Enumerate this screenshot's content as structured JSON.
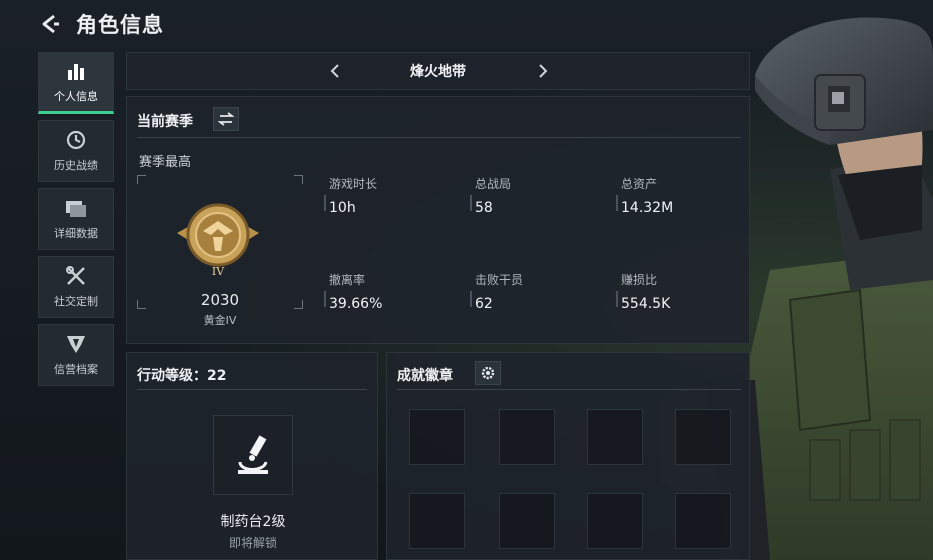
{
  "header": {
    "title": "角色信息"
  },
  "sidebar": {
    "items": [
      {
        "label": "个人信息",
        "icon": "bar-chart-icon",
        "active": true
      },
      {
        "label": "历史战绩",
        "icon": "history-clock-icon",
        "active": false
      },
      {
        "label": "详细数据",
        "icon": "folder-icon",
        "active": false
      },
      {
        "label": "社交定制",
        "icon": "tools-icon",
        "active": false
      },
      {
        "label": "信营档案",
        "icon": "emblem-icon",
        "active": false
      }
    ]
  },
  "mode_bar": {
    "name": "烽火地带",
    "prev_icon": "chevron-left-icon",
    "next_icon": "chevron-right-icon"
  },
  "season": {
    "title": "当前赛季",
    "best_label": "赛季最高",
    "rank_score": "2030",
    "rank_tier": "黄金IV",
    "rank_badge_numeral": "IV",
    "stats": [
      {
        "label": "游戏时长",
        "value": "10h"
      },
      {
        "label": "总战局",
        "value": "58"
      },
      {
        "label": "总资产",
        "value": "14.32M"
      },
      {
        "label": "撤离率",
        "value": "39.66%"
      },
      {
        "label": "击败干员",
        "value": "62"
      },
      {
        "label": "赚损比",
        "value": "554.5K"
      }
    ]
  },
  "level": {
    "title": "行动等级：22",
    "unlock_name": "制药台2级",
    "unlock_state": "即将解锁"
  },
  "badges": {
    "title": "成就徽章",
    "slots": 8
  },
  "colors": {
    "accent": "#3ecf8e",
    "gold": "#c9a25a"
  }
}
